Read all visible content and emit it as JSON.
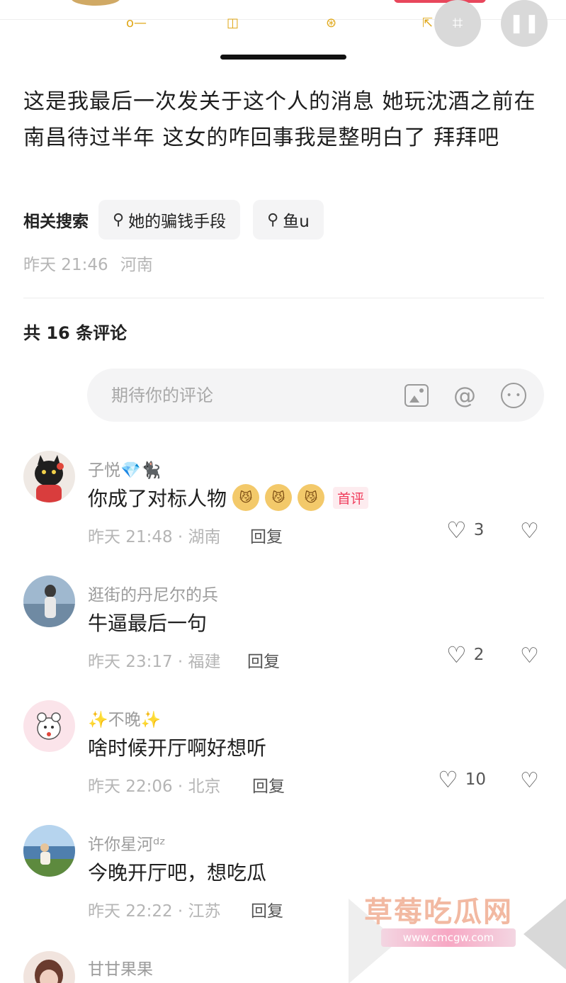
{
  "post": {
    "text": "这是我最后一次发关于这个人的消息  她玩沈酒之前在南昌待过半年  这女的咋回事我是整明白了  拜拜吧",
    "related_label": "相关搜索",
    "related_searches": [
      "她的骗钱手段",
      "鱼u"
    ],
    "time": "昨天 21:46",
    "location": "河南"
  },
  "comments_header": "共 16 条评论",
  "comment_input": {
    "placeholder": "期待你的评论"
  },
  "comments": [
    {
      "user": "子悦💎🐈‍⬛",
      "text": "你成了对标人物",
      "emojis": [
        "😼",
        "😼",
        "😼"
      ],
      "badge": "首评",
      "meta": "昨天 21:48 · 湖南",
      "reply": "回复",
      "likes": "3"
    },
    {
      "user": "逛街的丹尼尔的兵",
      "text": "牛逼最后一句",
      "meta": "昨天 23:17 · 福建",
      "reply": "回复",
      "likes": "2"
    },
    {
      "user": "✨不晚✨",
      "text": "啥时候开厅啊好想听",
      "meta": "昨天 22:06 · 北京",
      "reply": "回复",
      "likes": "10"
    },
    {
      "user": "许你星河ᵈᶻ",
      "text": "今晚开厅吧，想吃瓜",
      "meta": "昨天 22:22 · 江苏",
      "reply": "回复",
      "likes": ""
    },
    {
      "user": "甘甘果果"
    }
  ],
  "watermark": {
    "title": "草莓吃瓜网",
    "url": "www.cmcgw.com"
  },
  "icons": {
    "search": "magnifier-icon",
    "image": "image-icon",
    "at": "at-icon",
    "emoji": "emoji-icon",
    "like": "heart-icon",
    "dislike": "broken-heart-icon"
  }
}
